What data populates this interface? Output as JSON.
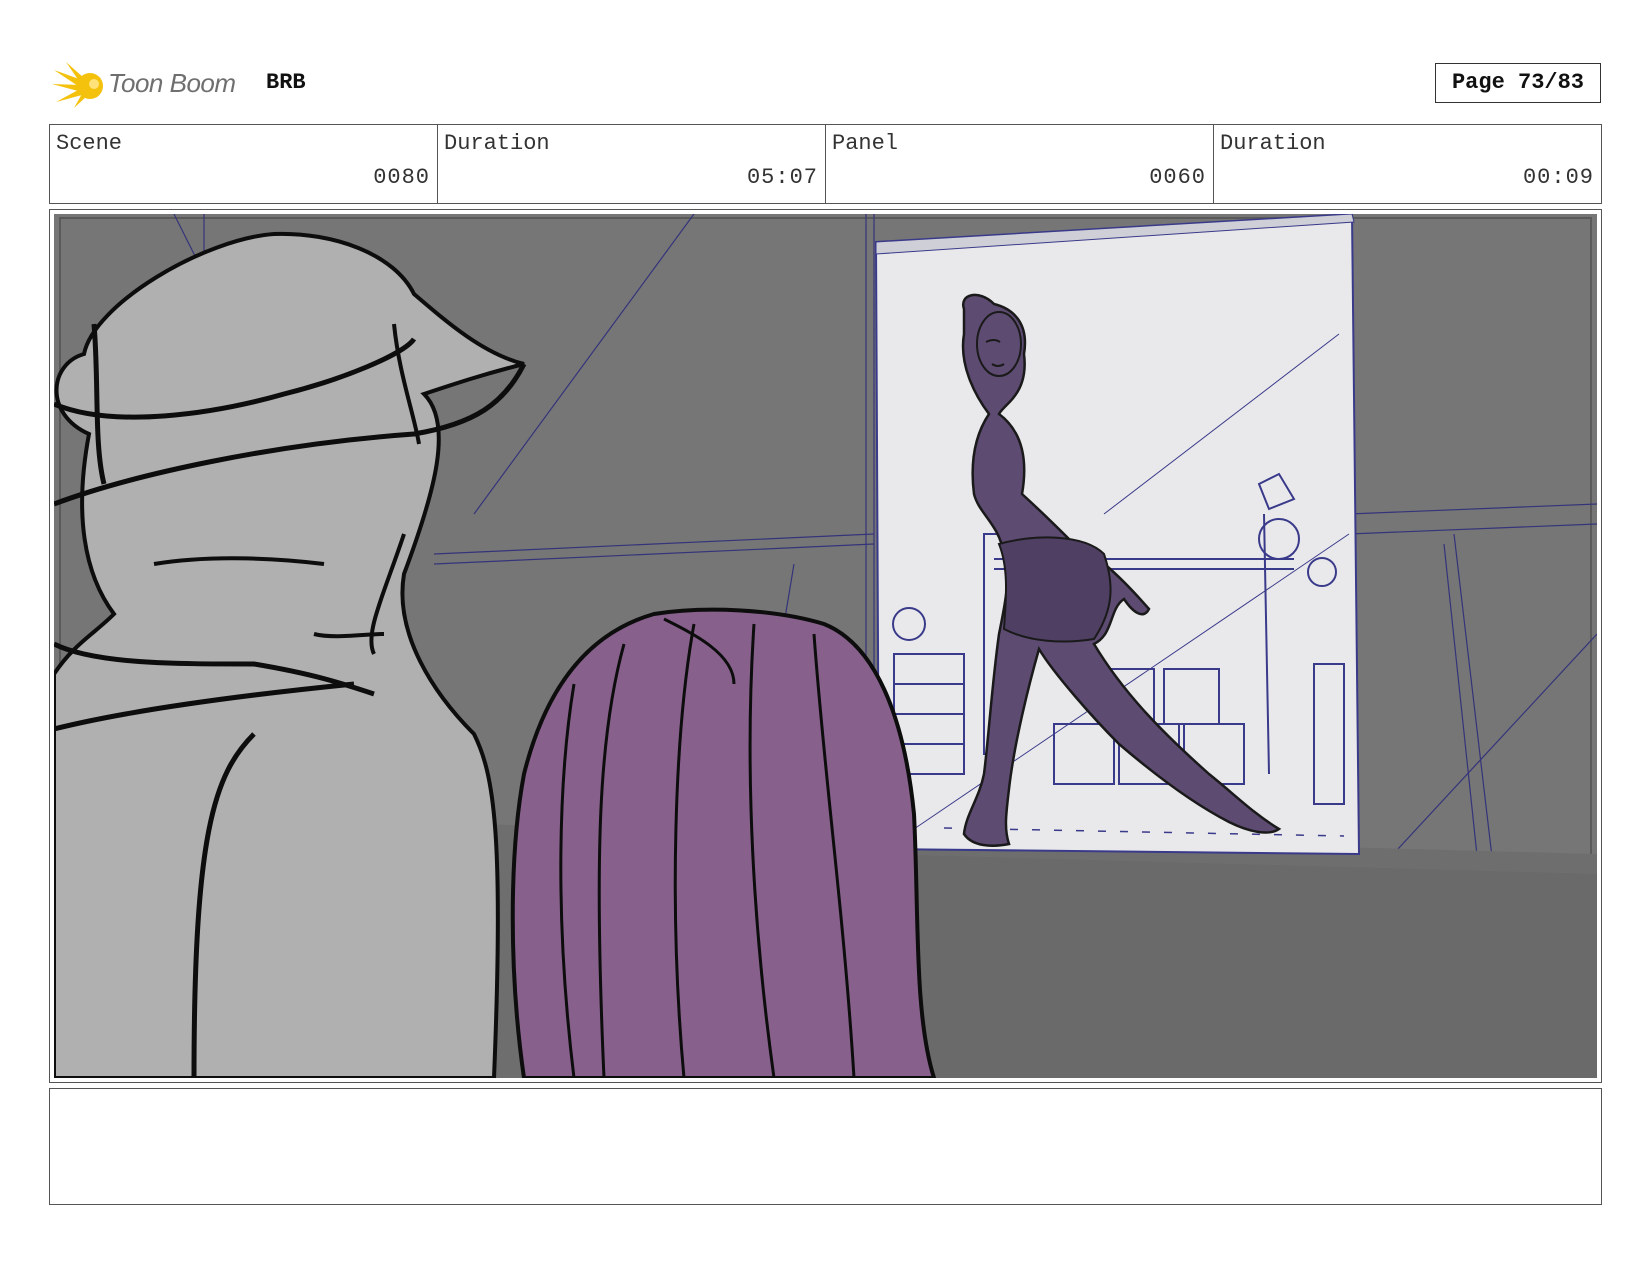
{
  "header": {
    "logo_text": "Toon Boom",
    "project": "BRB",
    "page": "Page 73/83"
  },
  "info": {
    "scene_label": "Scene",
    "scene_value": "0080",
    "scene_duration_label": "Duration",
    "scene_duration_value": "05:07",
    "panel_label": "Panel",
    "panel_value": "0060",
    "panel_duration_label": "Duration",
    "panel_duration_value": "00:09"
  },
  "notes": {
    "text": ""
  },
  "colors": {
    "logo_yellow": "#f4c20d",
    "wall_gray": "#7a7a7a",
    "character_gray": "#b0b0b0",
    "hair_purple": "#87618c",
    "figure_purple": "#5e4b72",
    "line_blue": "#3a3a8a"
  }
}
